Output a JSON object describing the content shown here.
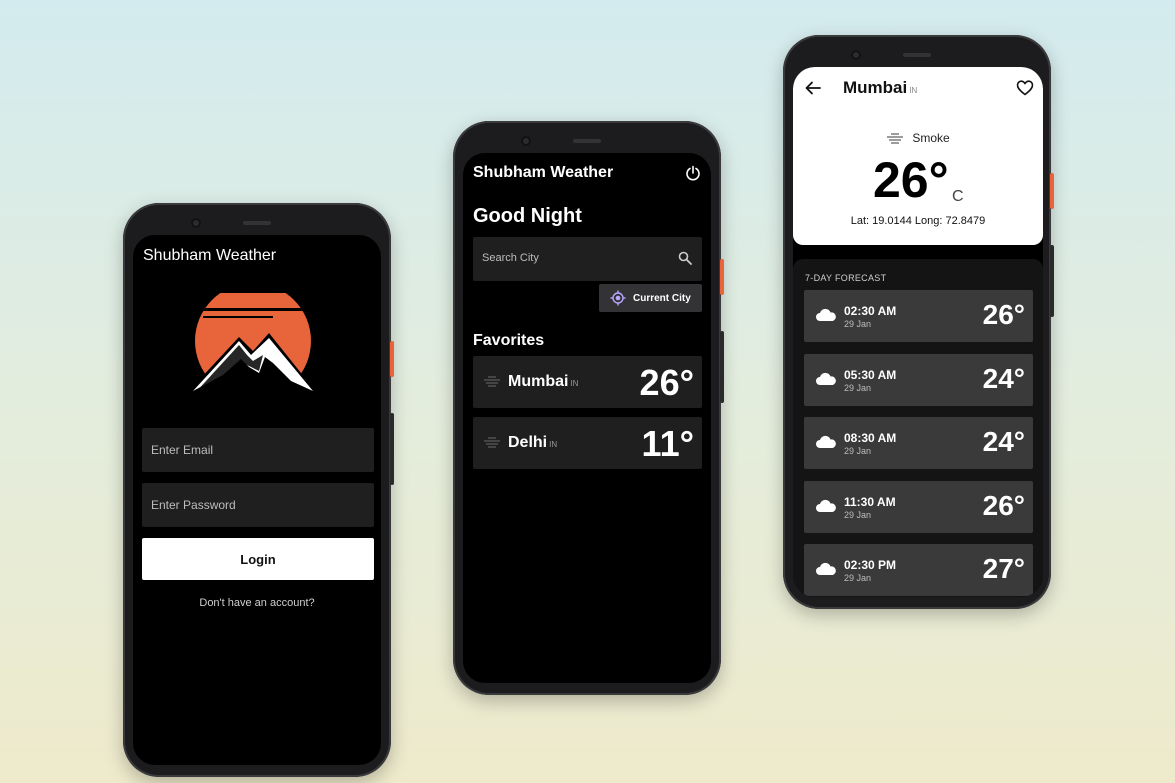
{
  "colors": {
    "accent_orange": "#e8643a",
    "screen_bg": "#000000",
    "card_bg": "#1f1f1f",
    "button_white": "#ffffff",
    "location_purple": "#b9a6ff"
  },
  "login": {
    "app_title": "Shubham Weather",
    "logo_icon": "sun-mountain-logo",
    "email_placeholder": "Enter Email",
    "password_placeholder": "Enter Password",
    "login_label": "Login",
    "signup_text": "Don't have an account?"
  },
  "home": {
    "app_title": "Shubham Weather",
    "power_icon": "power-icon",
    "greeting": "Good Night",
    "search_placeholder": "Search City",
    "current_city_label": "Current City",
    "favorites_title": "Favorites",
    "favorites": [
      {
        "city": "Mumbai",
        "country": "IN",
        "temp": "26°",
        "icon": "smoke-icon"
      },
      {
        "city": "Delhi",
        "country": "IN",
        "temp": "11°",
        "icon": "smoke-icon"
      }
    ]
  },
  "detail": {
    "city": "Mumbai",
    "country": "IN",
    "condition": "Smoke",
    "temp": "26°",
    "unit": "C",
    "coords": "Lat: 19.0144 Long: 72.8479",
    "forecast_title": "7-DAY FORECAST",
    "forecast": [
      {
        "time": "02:30 AM",
        "date": "29 Jan",
        "temp": "26°",
        "icon": "cloud-icon"
      },
      {
        "time": "05:30 AM",
        "date": "29 Jan",
        "temp": "24°",
        "icon": "cloud-icon"
      },
      {
        "time": "08:30 AM",
        "date": "29 Jan",
        "temp": "24°",
        "icon": "cloud-icon"
      },
      {
        "time": "11:30 AM",
        "date": "29 Jan",
        "temp": "26°",
        "icon": "cloud-icon"
      },
      {
        "time": "02:30 PM",
        "date": "29 Jan",
        "temp": "27°",
        "icon": "cloud-icon"
      }
    ]
  }
}
